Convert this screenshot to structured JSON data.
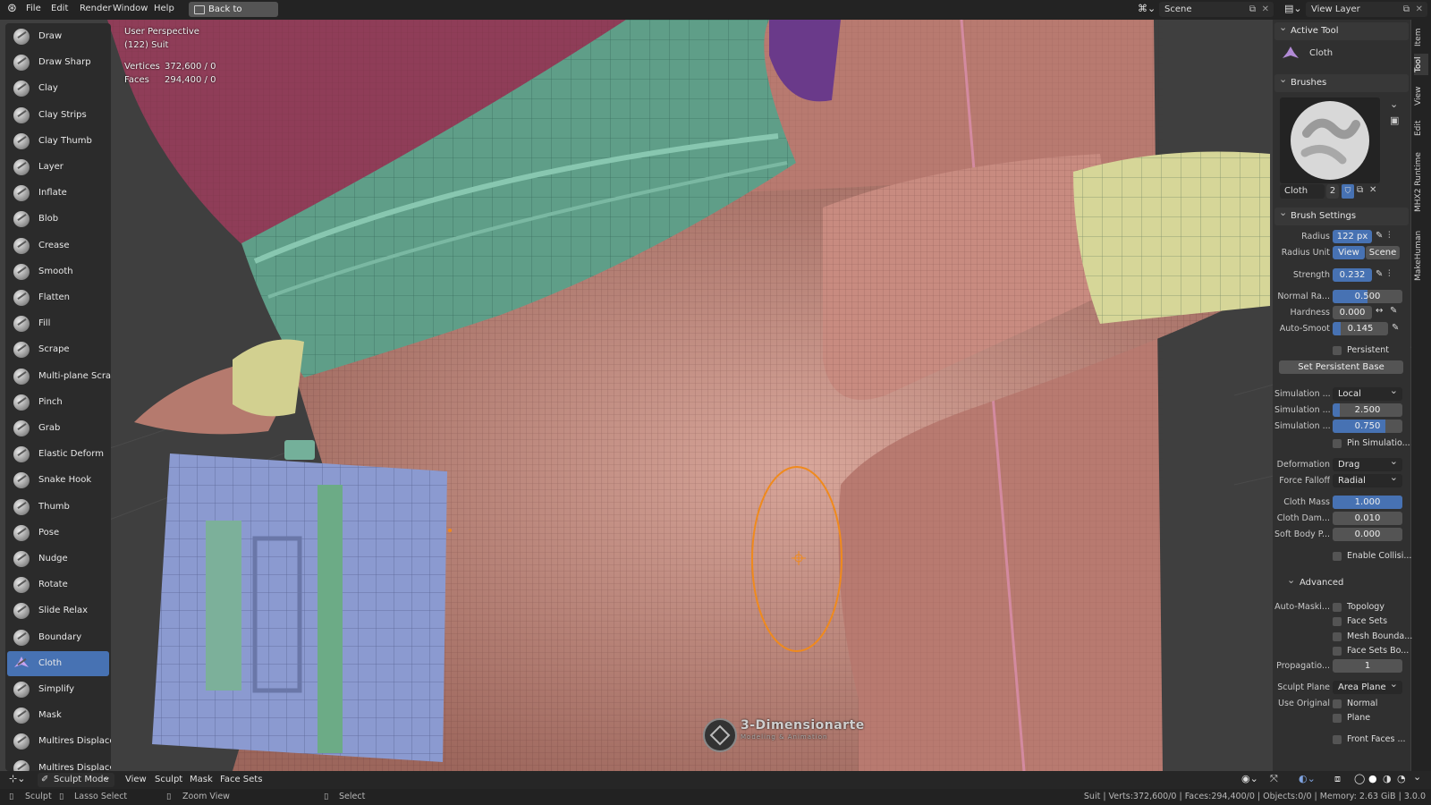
{
  "menu": {
    "file": "File",
    "edit": "Edit",
    "render": "Render",
    "window": "Window",
    "help": "Help",
    "back": "Back to Previous"
  },
  "top_right": {
    "scene": "Scene",
    "view_layer": "View Layer"
  },
  "viewport": {
    "perspective": "User Perspective",
    "object": "(122) Suit",
    "vertices_label": "Vertices",
    "vertices_value": "372,600 / 0",
    "faces_label": "Faces",
    "faces_value": "294,400 / 0",
    "watermark": "3-Dimensionarte",
    "watermark_sub": "Modeling & Animation"
  },
  "tools": [
    {
      "label": "Draw"
    },
    {
      "label": "Draw Sharp"
    },
    {
      "label": "Clay"
    },
    {
      "label": "Clay Strips"
    },
    {
      "label": "Clay Thumb"
    },
    {
      "label": "Layer"
    },
    {
      "label": "Inflate"
    },
    {
      "label": "Blob"
    },
    {
      "label": "Crease"
    },
    {
      "label": "Smooth"
    },
    {
      "label": "Flatten"
    },
    {
      "label": "Fill"
    },
    {
      "label": "Scrape"
    },
    {
      "label": "Multi-plane Scrape"
    },
    {
      "label": "Pinch"
    },
    {
      "label": "Grab"
    },
    {
      "label": "Elastic Deform"
    },
    {
      "label": "Snake Hook"
    },
    {
      "label": "Thumb"
    },
    {
      "label": "Pose"
    },
    {
      "label": "Nudge"
    },
    {
      "label": "Rotate"
    },
    {
      "label": "Slide Relax"
    },
    {
      "label": "Boundary"
    },
    {
      "label": "Cloth",
      "active": true
    },
    {
      "label": "Simplify"
    },
    {
      "label": "Mask"
    },
    {
      "label": "Multires Displace..."
    },
    {
      "label": "Multires Displace..."
    }
  ],
  "sidebar_tabs": [
    "Item",
    "Tool",
    "View",
    "Edit",
    "MHX2 Runtime",
    "MakeHuman"
  ],
  "panel": {
    "active_tool_header": "Active Tool",
    "active_tool_name": "Cloth",
    "brushes_header": "Brushes",
    "brush_name": "Cloth",
    "brush_users": "2",
    "brush_settings_header": "Brush Settings",
    "radius_label": "Radius",
    "radius_value": "122 px",
    "radius_unit_label": "Radius Unit",
    "radius_unit_view": "View",
    "radius_unit_scene": "Scene",
    "strength_label": "Strength",
    "strength_value": "0.232",
    "normal_radius_label": "Normal Ra...",
    "normal_radius_value": "0.500",
    "normal_radius_fill": 0.5,
    "hardness_label": "Hardness",
    "hardness_value": "0.000",
    "auto_smooth_label": "Auto-Smoot",
    "auto_smooth_value": "0.145",
    "auto_smooth_fill": 0.145,
    "persistent_label": "Persistent",
    "set_persistent_base": "Set Persistent Base",
    "sim1_label": "Simulation ...",
    "sim1_value": "Local",
    "sim2_label": "Simulation ...",
    "sim2_value": "2.500",
    "sim2_fill": 0.1,
    "sim3_label": "Simulation ...",
    "sim3_value": "0.750",
    "sim3_fill": 0.75,
    "pin_sim_label": "Pin Simulatio...",
    "deformation_label": "Deformation",
    "deformation_value": "Drag",
    "force_falloff_label": "Force Falloff",
    "force_falloff_value": "Radial",
    "cloth_mass_label": "Cloth Mass",
    "cloth_mass_value": "1.000",
    "cloth_mass_fill": 1.0,
    "cloth_damp_label": "Cloth Dam...",
    "cloth_damp_value": "0.010",
    "soft_body_label": "Soft Body P...",
    "soft_body_value": "0.000",
    "enable_collision_label": "Enable Collisi...",
    "advanced_header": "Advanced",
    "auto_mask_label": "Auto-Maski...",
    "mask_topology": "Topology",
    "mask_face_sets": "Face Sets",
    "mask_mesh_boundary": "Mesh Bounda...",
    "mask_face_sets_boundary": "Face Sets Bo...",
    "propagation_label": "Propagatio...",
    "propagation_value": "1",
    "sculpt_plane_label": "Sculpt Plane",
    "sculpt_plane_value": "Area Plane",
    "use_original_label": "Use Original",
    "use_original_normal": "Normal",
    "use_original_plane": "Plane",
    "front_faces": "Front Faces ..."
  },
  "header": {
    "mode": "Sculpt Mode",
    "view": "View",
    "sculpt": "Sculpt",
    "mask": "Mask",
    "face_sets": "Face Sets"
  },
  "status": {
    "sculpt": "Sculpt",
    "lasso": "Lasso Select",
    "zoom": "Zoom View",
    "select": "Select",
    "info": "Suit | Verts:372,600/0 | Faces:294,400/0 | Objects:0/0 | Memory: 2.63 GiB | 3.0.0"
  },
  "colors": {
    "accent": "#4772b3",
    "brush_cursor": "#f08a1c",
    "cloth": "#c98c80",
    "collar": "#5f9f8a",
    "cuff": "#d7d79a",
    "box": "#8a99c9"
  }
}
